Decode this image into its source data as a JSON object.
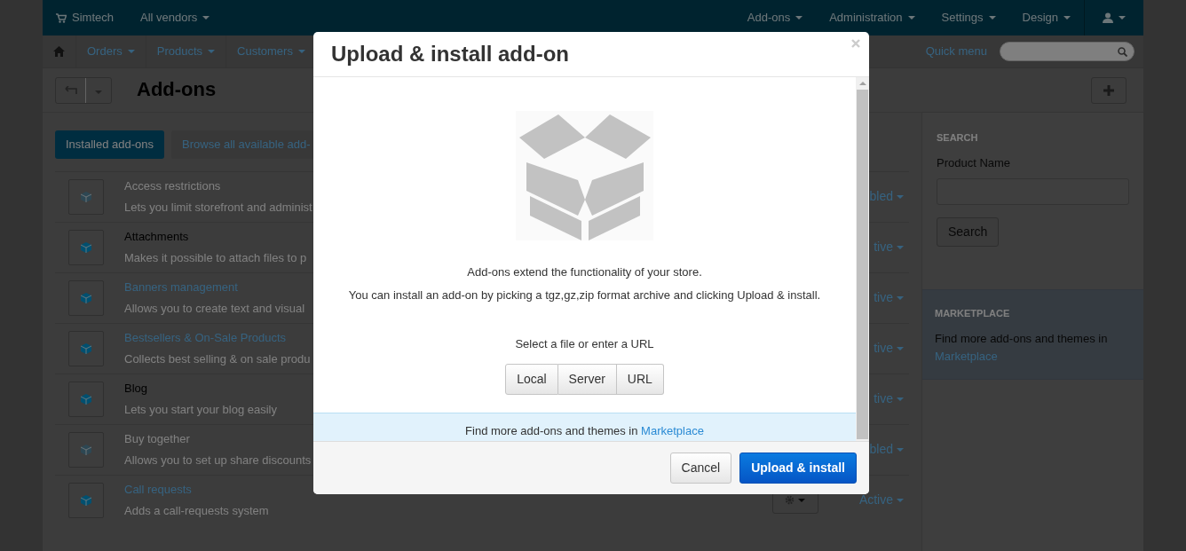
{
  "top_nav": {
    "brand": "Simtech",
    "vendor": "All vendors",
    "menus": [
      "Add-ons",
      "Administration",
      "Settings",
      "Design"
    ]
  },
  "sub_nav": {
    "items": [
      "Orders",
      "Products",
      "Customers"
    ],
    "quick_menu": "Quick menu"
  },
  "page": {
    "title": "Add-ons",
    "tabs": [
      {
        "label": "Installed add-ons",
        "selected": true
      },
      {
        "label": "Browse all available add-",
        "selected": false
      }
    ]
  },
  "addons": [
    {
      "name": "Access restrictions",
      "description": "Lets you limit storefront and administ",
      "enabled": false,
      "linked": false,
      "status": "bled"
    },
    {
      "name": "Attachments",
      "description": "Makes it possible to attach files to p",
      "enabled": true,
      "linked": false,
      "status": "tive"
    },
    {
      "name": "Banners management",
      "description": "Allows you to create text and visual",
      "enabled": true,
      "linked": true,
      "status": "tive"
    },
    {
      "name": "Bestsellers & On-Sale Products",
      "description": "Collects best selling & on sale produ",
      "enabled": true,
      "linked": true,
      "status": "tive"
    },
    {
      "name": "Blog",
      "description": "Lets you start your blog easily",
      "enabled": true,
      "linked": false,
      "status": "tive"
    },
    {
      "name": "Buy together",
      "description": "Allows you to set up share discounts",
      "enabled": false,
      "linked": false,
      "status": "bled"
    },
    {
      "name": "Call requests",
      "description": "Adds a call-requests system",
      "enabled": true,
      "linked": true,
      "status": "Active",
      "settings_button": true
    }
  ],
  "sidebar": {
    "search": {
      "heading": "SEARCH",
      "label": "Product Name",
      "button": "Search"
    },
    "marketplace": {
      "heading": "MARKETPLACE",
      "text": "Find more add-ons and themes in",
      "link": "Marketplace"
    }
  },
  "modal": {
    "title": "Upload & install add-on",
    "lines": [
      "Add-ons extend the functionality of your store.",
      "You can install an add-on by picking a tgz,gz,zip format archive and clicking Upload & install."
    ],
    "select_label": "Select a file or enter a URL",
    "sources": [
      "Local",
      "Server",
      "URL"
    ],
    "note": {
      "text": "Find more add-ons and themes in",
      "link": "Marketplace"
    },
    "buttons": [
      {
        "label": "Cancel",
        "kind": "default"
      },
      {
        "label": "Upload & install",
        "kind": "primary"
      }
    ]
  }
}
